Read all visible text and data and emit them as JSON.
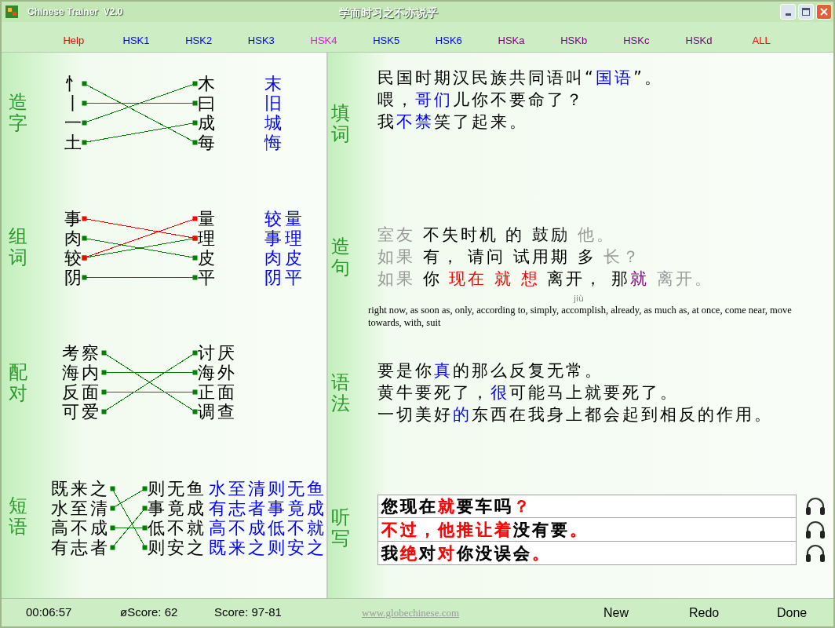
{
  "window": {
    "title": "Chinese Trainer  V2.0",
    "caption": "学而时习之不亦说乎"
  },
  "menu": [
    {
      "label": "Help",
      "color": "#ff0000"
    },
    {
      "label": "HSK1",
      "color": "#0000ff"
    },
    {
      "label": "HSK2",
      "color": "#0000ff"
    },
    {
      "label": "HSK3",
      "color": "#0000ff"
    },
    {
      "label": "HSK4",
      "color": "#ff00ff"
    },
    {
      "label": "HSK5",
      "color": "#0000ff"
    },
    {
      "label": "HSK6",
      "color": "#0000ff"
    },
    {
      "label": "HSKa",
      "color": "#800080"
    },
    {
      "label": "HSKb",
      "color": "#800080"
    },
    {
      "label": "HSKc",
      "color": "#800080"
    },
    {
      "label": "HSKd",
      "color": "#800080"
    },
    {
      "label": "ALL",
      "color": "#ff0000"
    }
  ],
  "match_sections": [
    {
      "label": "造字",
      "left": [
        "忄",
        "丨",
        "一",
        "土"
      ],
      "right": [
        "木",
        "曰",
        "成",
        "每"
      ],
      "links": [
        {
          "color": "#008000"
        },
        {
          "color": "#008000"
        },
        {
          "color": "#008000"
        },
        {
          "color": "#008000"
        }
      ],
      "answers": [
        "末",
        "旧",
        "城",
        "悔"
      ]
    },
    {
      "label": "组词",
      "left": [
        "事",
        "肉",
        "较",
        "阴"
      ],
      "right": [
        "量",
        "理",
        "皮",
        "平"
      ],
      "links": [
        {
          "color": "#008000"
        },
        {
          "color": "#008000"
        },
        {
          "color": "#008000"
        },
        {
          "color": "#ff0000"
        },
        {
          "color": "#ff0000"
        }
      ],
      "answers": [
        "较量",
        "事理",
        "肉皮",
        "阴平"
      ]
    },
    {
      "label": "配对",
      "left": [
        "考察",
        "海内",
        "反面",
        "可爱"
      ],
      "right": [
        "讨厌",
        "海外",
        "正面",
        "调查"
      ],
      "links": [
        {
          "color": "#008000"
        },
        {
          "color": "#008000"
        },
        {
          "color": "#008000"
        },
        {
          "color": "#008000"
        }
      ]
    },
    {
      "label": "短语",
      "left": [
        "既来之",
        "水至清",
        "高不成",
        "有志者"
      ],
      "right": [
        "则无鱼",
        "事竟成",
        "低不就",
        "则安之"
      ],
      "links": [
        {
          "color": "#008000"
        },
        {
          "color": "#008000"
        },
        {
          "color": "#008000"
        },
        {
          "color": "#008000"
        }
      ],
      "answers": [
        "水至清则无鱼",
        "有志者事竟成",
        "高不成低不就",
        "既来之则安之"
      ]
    }
  ],
  "exercises": [
    {
      "label": "填词",
      "kind": "sentences",
      "sentences": [
        [
          {
            "text": "民国时期汉民族共同语叫“",
            "color": "#000000"
          },
          {
            "text": "国语",
            "color": "#0000ff"
          },
          {
            "text": "”。",
            "color": "#000000"
          }
        ],
        [
          {
            "text": "喂，",
            "color": "#000000"
          },
          {
            "text": "哥们",
            "color": "#0000ff"
          },
          {
            "text": "儿你不要命了？",
            "color": "#000000"
          }
        ],
        [
          {
            "text": "我",
            "color": "#000000"
          },
          {
            "text": "不禁",
            "color": "#0000ff"
          },
          {
            "text": "笑了起来。",
            "color": "#000000"
          }
        ]
      ]
    },
    {
      "label": "造句",
      "kind": "sentences",
      "sentences": [
        [
          {
            "text": "室友 ",
            "color": "#999999"
          },
          {
            "text": "不失时机 的 鼓励 ",
            "color": "#000000"
          },
          {
            "text": "他。",
            "color": "#999999"
          }
        ],
        [
          {
            "text": "如果 ",
            "color": "#999999"
          },
          {
            "text": "有， 请问 试用期 多 ",
            "color": "#000000"
          },
          {
            "text": "长？",
            "color": "#999999"
          }
        ],
        [
          {
            "text": "如果 ",
            "color": "#999999"
          },
          {
            "text": "你 ",
            "color": "#000000"
          },
          {
            "text": "现在 就 想",
            "color": "#ff0000"
          },
          {
            "text": " 离开， 那",
            "color": "#000000"
          },
          {
            "text": "就",
            "color": "#800080"
          },
          {
            "text": " 离开。",
            "color": "#999999"
          }
        ]
      ],
      "pinyin": "jiù",
      "definition": "right now, as soon as, only, according to, simply, accomplish, already, as much as, at once, come near, move towards, with, suit"
    },
    {
      "label": "语法",
      "kind": "sentences",
      "sentences": [
        [
          {
            "text": "要是你",
            "color": "#000000"
          },
          {
            "text": "真",
            "color": "#0000ff"
          },
          {
            "text": "的那么反复无常。",
            "color": "#000000"
          }
        ],
        [
          {
            "text": "黄牛要死了，",
            "color": "#000000"
          },
          {
            "text": "很",
            "color": "#0000ff"
          },
          {
            "text": "可能马上就要死了。",
            "color": "#000000"
          }
        ],
        [
          {
            "text": "一切美好",
            "color": "#000000"
          },
          {
            "text": "的",
            "color": "#0000ff"
          },
          {
            "text": "东西在我身上都会起到相反的作用。",
            "color": "#000000"
          }
        ]
      ]
    },
    {
      "label": "听写",
      "kind": "dictation",
      "sentences": [
        [
          {
            "text": "您现在",
            "color": "#000000"
          },
          {
            "text": "就",
            "color": "#ff0000"
          },
          {
            "text": "要车吗",
            "color": "#000000"
          },
          {
            "text": "？",
            "color": "#ff0000"
          }
        ],
        [
          {
            "text": "不过，他推让着",
            "color": "#ff0000"
          },
          {
            "text": "没有要",
            "color": "#000000"
          },
          {
            "text": "。",
            "color": "#ff0000"
          }
        ],
        [
          {
            "text": "我",
            "color": "#000000"
          },
          {
            "text": "绝",
            "color": "#ff0000"
          },
          {
            "text": "对",
            "color": "#000000"
          },
          {
            "text": "对",
            "color": "#ff0000"
          },
          {
            "text": "你没误会",
            "color": "#000000"
          },
          {
            "text": "。",
            "color": "#ff0000"
          }
        ]
      ]
    }
  ],
  "status_bar": {
    "time": "00:06:57",
    "average_score": "øScore: 62",
    "score": "Score: 97-81",
    "link": "www.globechinese.com",
    "buttons": [
      "New",
      "Redo",
      "Done"
    ]
  }
}
